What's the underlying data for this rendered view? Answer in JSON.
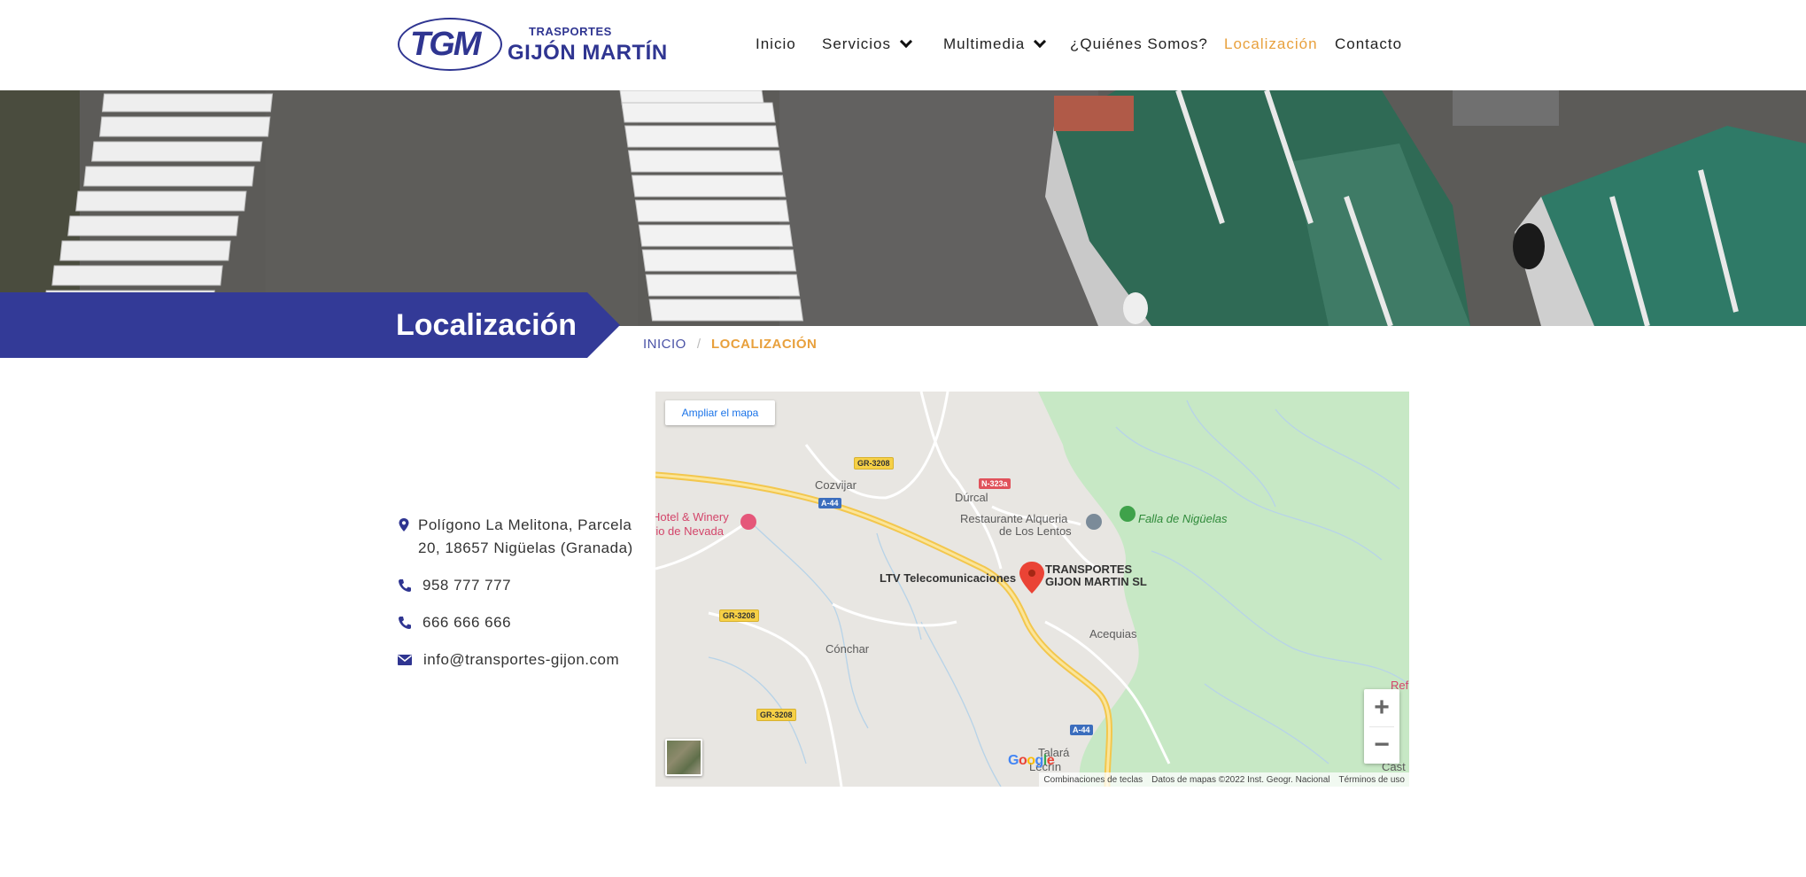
{
  "logo": {
    "mark": "TGM",
    "line1": "TRASPORTES",
    "line2": "GIJÓN MARTÍN"
  },
  "nav": {
    "items": [
      {
        "label": "Inicio"
      },
      {
        "label": "Servicios"
      },
      {
        "label": "Multimedia"
      },
      {
        "label": "¿Quiénes Somos?"
      },
      {
        "label": "Localización"
      },
      {
        "label": "Contacto"
      }
    ],
    "active_color": "#e8a03c"
  },
  "page": {
    "title": "Localización",
    "breadcrumb": {
      "home": "INICIO",
      "separator": "/",
      "current": "LOCALIZACIÓN"
    }
  },
  "contact": {
    "address": "Polígono La Melitona, Parcela 20, 18657 Nigüelas (Granada)",
    "phone1": "958 777 777",
    "phone2": "666 666 666",
    "email": "info@transportes-gijon.com"
  },
  "map": {
    "enlarge_label": "Ampliar el mapa",
    "place_name": "TRANSPORTES GIJON MARTIN SL",
    "place_name_line1": "TRANSPORTES",
    "place_name_line2": "GIJON MARTIN SL",
    "labels": {
      "cozvijar": "Cozvijar",
      "durcal": "Dúrcal",
      "restaurante_line1": "Restaurante Alqueria",
      "restaurante_line2": "de Los Lentos",
      "falla": "Falla de Nigüelas",
      "hotel_line1": "Hotel & Winery",
      "hotel_line2": "rio de Nevada",
      "ltv": "LTV Telecomunicaciones",
      "acequias": "Acequias",
      "conchar": "Cónchar",
      "talara": "Talará",
      "lecrin": "Lecrín",
      "ref": "Ref",
      "cast": "Cast"
    },
    "roads": {
      "gr3208": "GR-3208",
      "a44": "A-44",
      "n323a": "N-323a"
    },
    "zoom_in": "+",
    "zoom_out": "−",
    "google": "Google",
    "attribution": {
      "shortcuts": "Combinaciones de teclas",
      "data": "Datos de mapas ©2022 Inst. Geogr. Nacional",
      "terms": "Términos de uso"
    }
  },
  "colors": {
    "brand_blue": "#2f3591",
    "accent_orange": "#e8a03c",
    "banner_blue": "#333a97"
  }
}
